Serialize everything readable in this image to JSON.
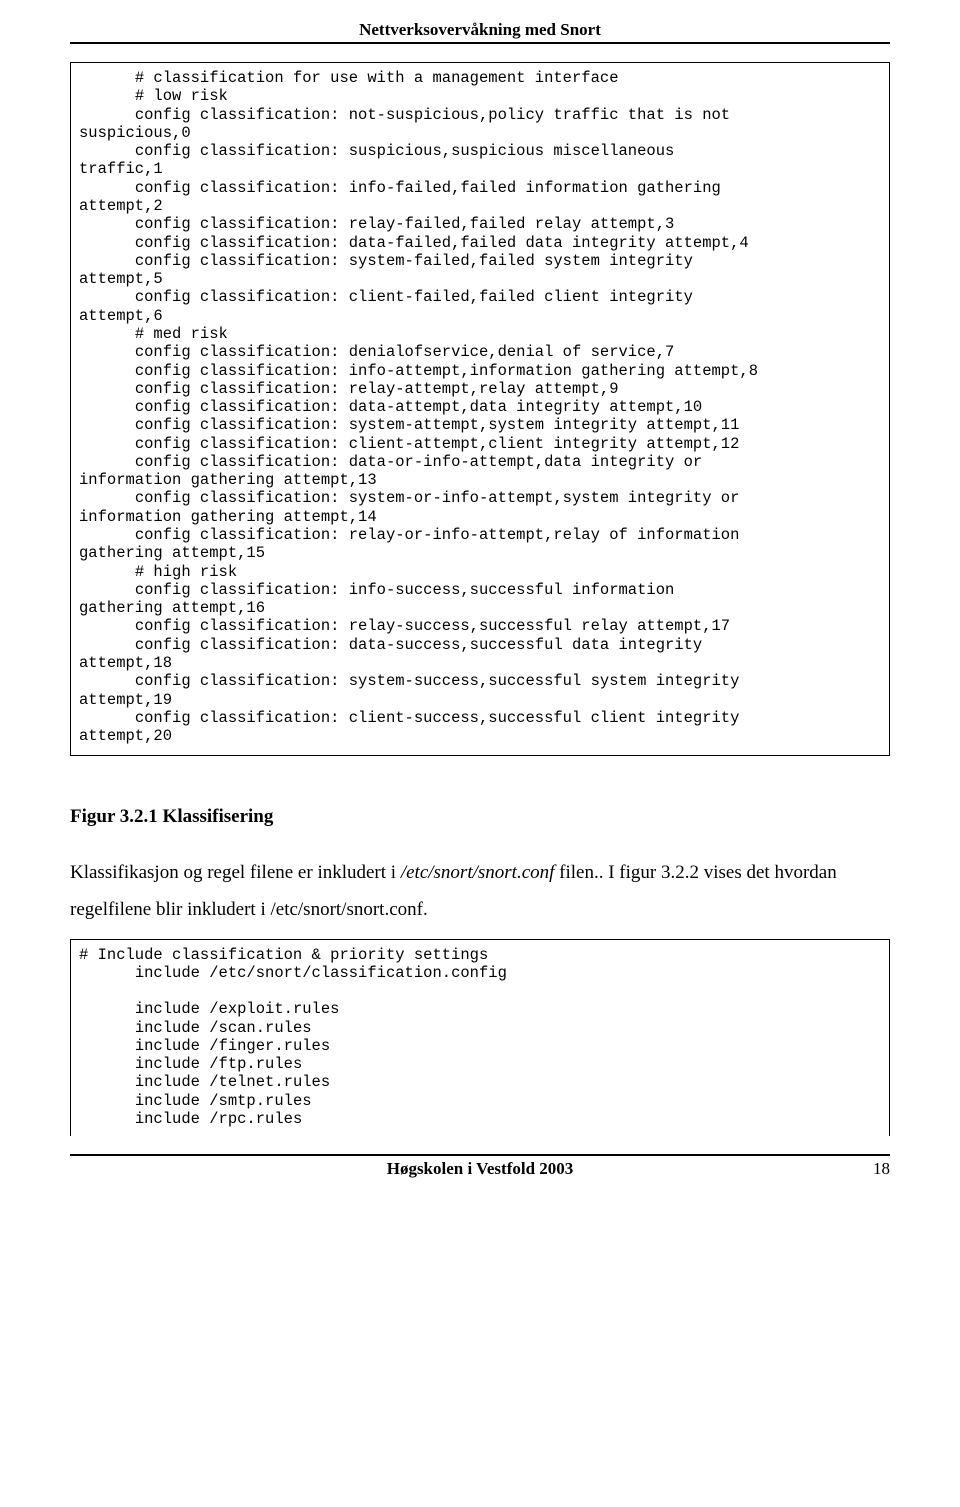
{
  "header": "Nettverksovervåkning med Snort",
  "code_block_1": "      # classification for use with a management interface\n      # low risk\n      config classification: not-suspicious,policy traffic that is not\nsuspicious,0\n      config classification: suspicious,suspicious miscellaneous\ntraffic,1\n      config classification: info-failed,failed information gathering\nattempt,2\n      config classification: relay-failed,failed relay attempt,3\n      config classification: data-failed,failed data integrity attempt,4\n      config classification: system-failed,failed system integrity\nattempt,5\n      config classification: client-failed,failed client integrity\nattempt,6\n      # med risk\n      config classification: denialofservice,denial of service,7\n      config classification: info-attempt,information gathering attempt,8\n      config classification: relay-attempt,relay attempt,9\n      config classification: data-attempt,data integrity attempt,10\n      config classification: system-attempt,system integrity attempt,11\n      config classification: client-attempt,client integrity attempt,12\n      config classification: data-or-info-attempt,data integrity or\ninformation gathering attempt,13\n      config classification: system-or-info-attempt,system integrity or\ninformation gathering attempt,14\n      config classification: relay-or-info-attempt,relay of information\ngathering attempt,15\n      # high risk\n      config classification: info-success,successful information\ngathering attempt,16\n      config classification: relay-success,successful relay attempt,17\n      config classification: data-success,successful data integrity\nattempt,18\n      config classification: system-success,successful system integrity\nattempt,19\n      config classification: client-success,successful client integrity\nattempt,20\n",
  "figure_heading": "Figur 3.2.1 Klassifisering",
  "para": {
    "pre": "Klassifikasjon og regel filene er inkludert i ",
    "italic1": "/etc/snort/snort.conf",
    "mid": " filen.. I figur 3.2.2 vises det hvordan regelfilene blir inkludert i /etc/snort/snort.conf."
  },
  "code_block_2": "# Include classification & priority settings\n      include /etc/snort/classification.config\n\n      include /exploit.rules\n      include /scan.rules\n      include /finger.rules\n      include /ftp.rules\n      include /telnet.rules\n      include /smtp.rules\n      include /rpc.rules",
  "footer": {
    "center": "Høgskolen i Vestfold 2003",
    "page": "18"
  }
}
